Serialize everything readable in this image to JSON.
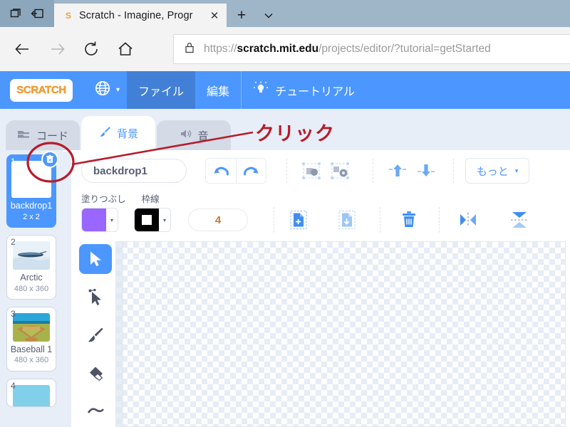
{
  "browser": {
    "titlebar_icons": [
      "set-tabs-aside-icon",
      "restore-tabs-icon"
    ],
    "tab": {
      "favicon": "scratch-favicon",
      "title": "Scratch - Imagine, Progr",
      "close_label": "✕"
    },
    "new_tab_label": "+",
    "tab_menu_label": "⌄",
    "nav": {
      "back_label": "←",
      "forward_label": "→",
      "reload_label": "↻",
      "home_label": "⌂"
    },
    "address": {
      "lock_icon": "lock-icon",
      "url_prefix": "https://",
      "url_domain": "scratch.mit.edu",
      "url_path": "/projects/editor/?tutorial=getStarted",
      "full_url": "https://scratch.mit.edu/projects/editor/?tutorial=getStarted"
    }
  },
  "scratch_menu": {
    "logo_text": "SCRATCH",
    "globe_icon": "globe-icon",
    "globe_caret": "▾",
    "items": [
      {
        "label": "ファイル",
        "active": true
      },
      {
        "label": "編集",
        "active": false
      },
      {
        "label": "チュートリアル",
        "icon": "lightbulb-icon",
        "active": false
      }
    ]
  },
  "tabs": [
    {
      "label": "コード",
      "icon": "code-blocks-icon",
      "active": false
    },
    {
      "label": "背景",
      "icon": "paintbrush-icon",
      "active": true
    },
    {
      "label": "音",
      "icon": "speaker-icon",
      "active": false
    }
  ],
  "backdrop_list": [
    {
      "number": "1",
      "name": "backdrop1",
      "size": "2 x 2",
      "selected": true,
      "thumb": "blank"
    },
    {
      "number": "2",
      "name": "Arctic",
      "size": "480 x 360",
      "selected": false,
      "thumb": "arctic"
    },
    {
      "number": "3",
      "name": "Baseball 1",
      "size": "480 x 360",
      "selected": false,
      "thumb": "baseball"
    },
    {
      "number": "4",
      "name": "",
      "size": "",
      "selected": false,
      "thumb": "partial"
    }
  ],
  "paint_editor": {
    "name_value": "backdrop1",
    "name_placeholder": "backdrop1",
    "undo_icon": "undo-icon",
    "redo_icon": "redo-icon",
    "group_icon": "group-icon",
    "ungroup_icon": "ungroup-icon",
    "forward_icon": "bring-forward-icon",
    "backward_icon": "send-backward-icon",
    "more_label": "もっと",
    "more_caret": "▾",
    "fill_label": "塗りつぶし",
    "outline_label": "枠線",
    "fill_color": "#9966FF",
    "outline_color": "#000000",
    "stroke_width": "4",
    "caret_glyph": "▾",
    "copy_icon": "copy-icon",
    "paste_icon": "paste-icon",
    "delete_icon": "trash-icon",
    "flip_horizontal_icon": "flip-horizontal-icon",
    "flip_vertical_icon": "flip-vertical-icon"
  },
  "tools": [
    {
      "name": "select-tool",
      "icon": "arrow-cursor-icon",
      "active": true
    },
    {
      "name": "reshape-tool",
      "icon": "reshape-cursor-icon",
      "active": false
    },
    {
      "name": "brush-tool",
      "icon": "paintbrush-icon",
      "active": false
    },
    {
      "name": "eraser-tool",
      "icon": "eraser-icon",
      "active": false
    },
    {
      "name": "fill-tool",
      "icon": "fill-icon",
      "active": false
    }
  ],
  "annotation": {
    "text": "クリック",
    "color": "#b71c2b",
    "target": "delete-backdrop-badge"
  },
  "colors": {
    "scratch_blue": "#4c97ff",
    "menu_active": "#4280d7",
    "body_bg": "#e8eef7",
    "titlebar": "#9fb6c8",
    "annotation_red": "#b71c2b",
    "fill_purple": "#9966FF",
    "stroke_number": "#c9762a"
  }
}
